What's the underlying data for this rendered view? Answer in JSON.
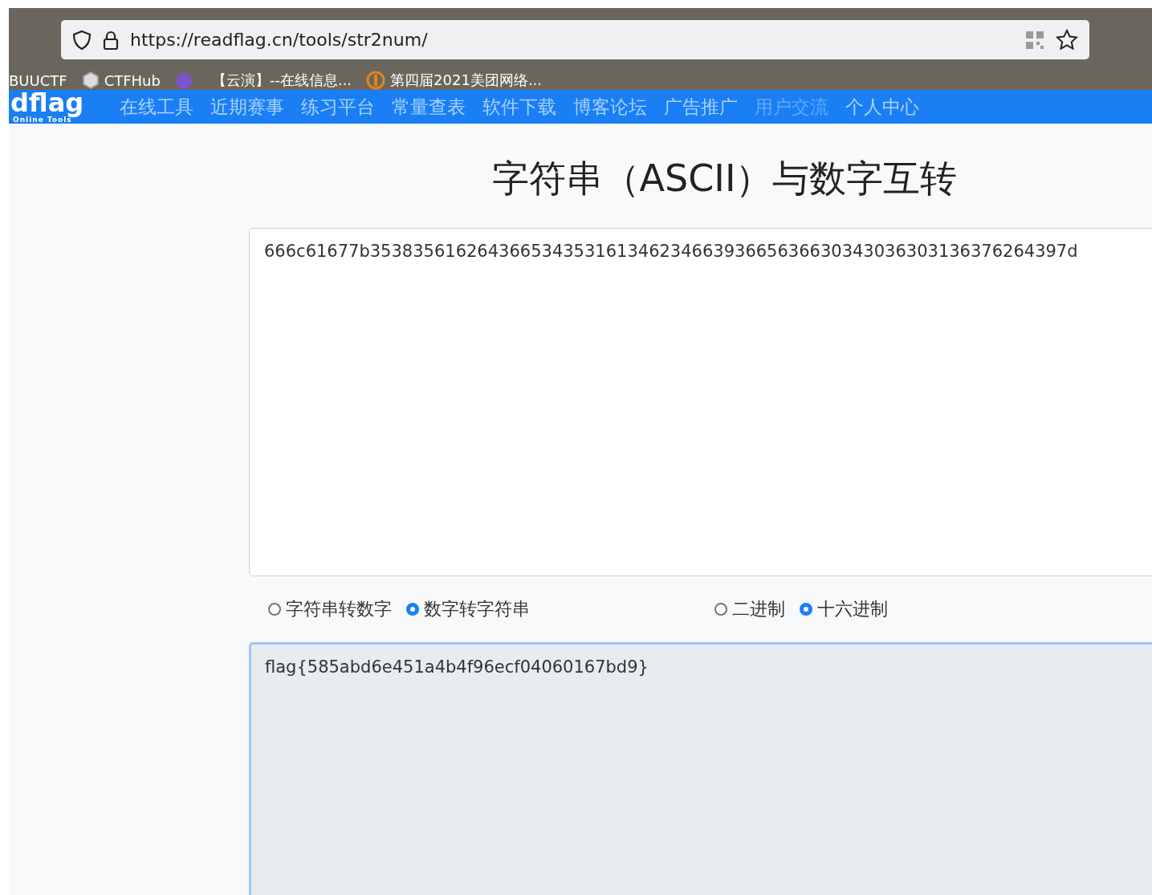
{
  "browser": {
    "url": "https://readflag.cn/tools/str2num/",
    "bookmarks": [
      "BUUCTF",
      "CTFHub",
      "【云演】--在线信息...",
      "第四届2021美团网络..."
    ]
  },
  "navbar": {
    "logo": "dflag",
    "logo_sub": "Online Tools",
    "items": [
      {
        "label": "在线工具",
        "disabled": false
      },
      {
        "label": "近期赛事",
        "disabled": false
      },
      {
        "label": "练习平台",
        "disabled": false
      },
      {
        "label": "常量查表",
        "disabled": false
      },
      {
        "label": "软件下载",
        "disabled": false
      },
      {
        "label": "博客论坛",
        "disabled": false
      },
      {
        "label": "广告推广",
        "disabled": false
      },
      {
        "label": "用户交流",
        "disabled": true
      },
      {
        "label": "个人中心",
        "disabled": false
      }
    ]
  },
  "title": "字符串（ASCII）与数字互转",
  "input": {
    "value": "666c61677b35383561626436653435316134623466393665636630343036303136376264397d"
  },
  "direction_options": [
    {
      "label": "字符串转数字",
      "selected": false
    },
    {
      "label": "数字转字符串",
      "selected": true
    }
  ],
  "base_options": [
    {
      "label": "二进制",
      "selected": false
    },
    {
      "label": "十六进制",
      "selected": true
    }
  ],
  "output": {
    "value": "flag{585abd6e451a4b4f96ecf04060167bd9}"
  }
}
